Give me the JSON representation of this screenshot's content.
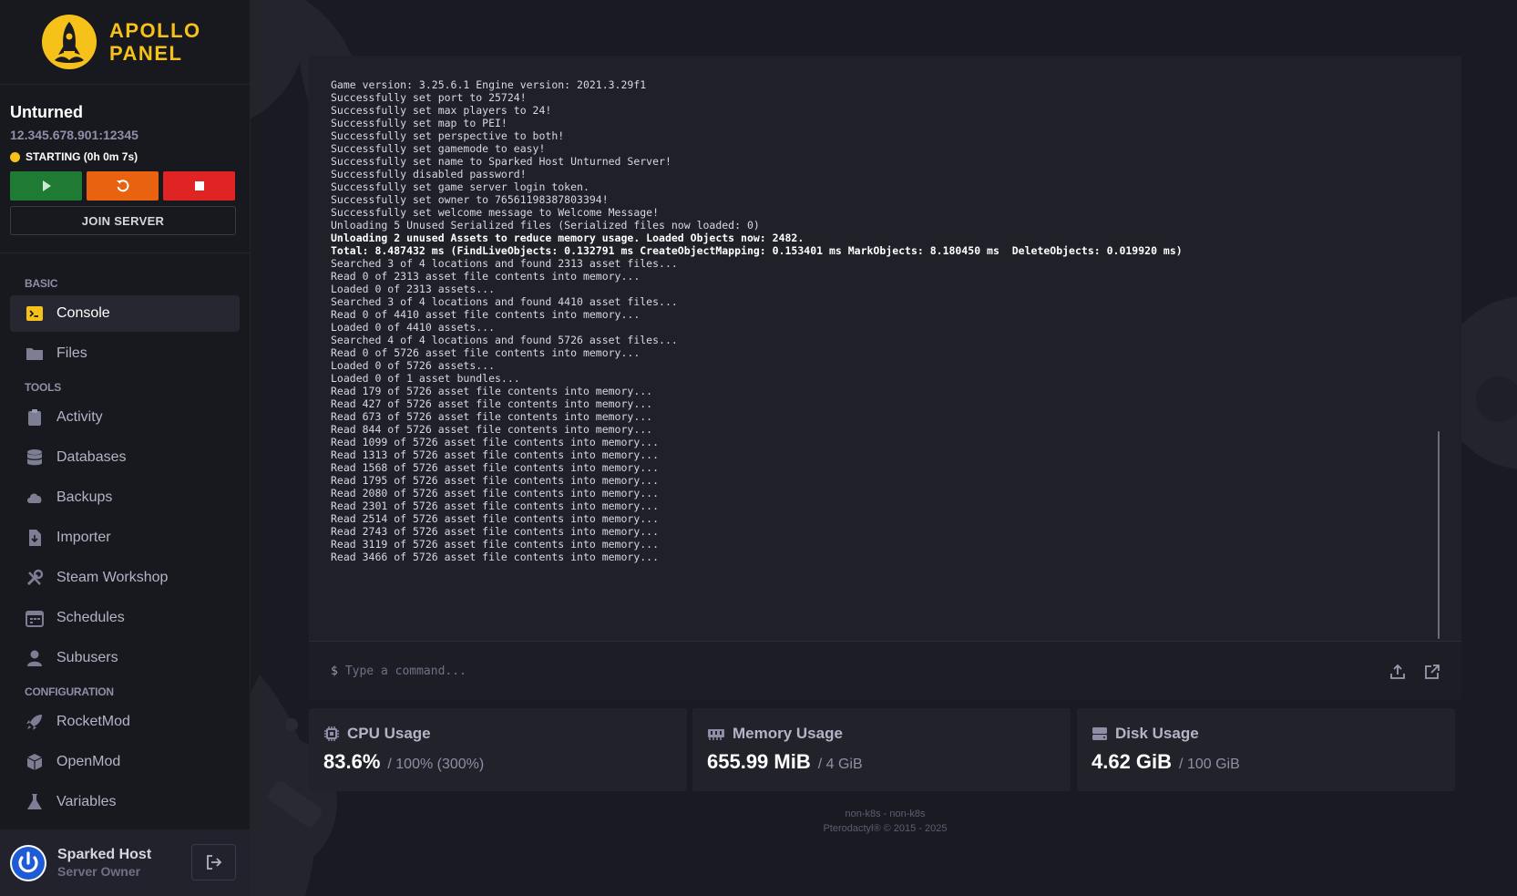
{
  "brand": {
    "line1": "APOLLO",
    "line2": "PANEL"
  },
  "server": {
    "name": "Unturned",
    "address": "12.345.678.901:12345",
    "status": "STARTING (0h 0m 7s)",
    "join_label": "JOIN SERVER"
  },
  "nav": {
    "basic_title": "BASIC",
    "tools_title": "TOOLS",
    "config_title": "CONFIGURATION",
    "console": "Console",
    "files": "Files",
    "activity": "Activity",
    "databases": "Databases",
    "backups": "Backups",
    "importer": "Importer",
    "steam_workshop": "Steam Workshop",
    "schedules": "Schedules",
    "subusers": "Subusers",
    "rocketmod": "RocketMod",
    "openmod": "OpenMod",
    "variables": "Variables"
  },
  "user": {
    "name": "Sparked Host",
    "role": "Server Owner"
  },
  "console": {
    "lines": [
      "Game version: 3.25.6.1 Engine version: 2021.3.29f1",
      "Successfully set port to 25724!",
      "Successfully set max players to 24!",
      "Successfully set map to PEI!",
      "Successfully set perspective to both!",
      "Successfully set gamemode to easy!",
      "Successfully set name to Sparked Host Unturned Server!",
      "Successfully disabled password!",
      "Successfully set game server login token.",
      "Successfully set owner to 76561198387803394!",
      "Successfully set welcome message to Welcome Message!",
      "Unloading 5 Unused Serialized files (Serialized files now loaded: 0)",
      "Unloading 2 unused Assets to reduce memory usage. Loaded Objects now: 2482.",
      "Total: 8.487432 ms (FindLiveObjects: 0.132791 ms CreateObjectMapping: 0.153401 ms MarkObjects: 8.180450 ms  DeleteObjects: 0.019920 ms)",
      "Searched 3 of 4 locations and found 2313 asset files...",
      "Read 0 of 2313 asset file contents into memory...",
      "Loaded 0 of 2313 assets...",
      "Searched 3 of 4 locations and found 4410 asset files...",
      "Read 0 of 4410 asset file contents into memory...",
      "Loaded 0 of 4410 assets...",
      "Searched 4 of 4 locations and found 5726 asset files...",
      "Read 0 of 5726 asset file contents into memory...",
      "Loaded 0 of 5726 assets...",
      "Loaded 0 of 1 asset bundles...",
      "Read 179 of 5726 asset file contents into memory...",
      "Read 427 of 5726 asset file contents into memory...",
      "Read 673 of 5726 asset file contents into memory...",
      "Read 844 of 5726 asset file contents into memory...",
      "Read 1099 of 5726 asset file contents into memory...",
      "Read 1313 of 5726 asset file contents into memory...",
      "Read 1568 of 5726 asset file contents into memory...",
      "Read 1795 of 5726 asset file contents into memory...",
      "Read 2080 of 5726 asset file contents into memory...",
      "Read 2301 of 5726 asset file contents into memory...",
      "Read 2514 of 5726 asset file contents into memory...",
      "Read 2743 of 5726 asset file contents into memory...",
      "Read 3119 of 5726 asset file contents into memory...",
      "Read 3466 of 5726 asset file contents into memory..."
    ],
    "strong_lines": [
      12,
      13
    ],
    "prompt": "$",
    "placeholder": "Type a command..."
  },
  "stats": {
    "cpu": {
      "title": "CPU Usage",
      "value": "83.6%",
      "limit": "/ 100% (300%)"
    },
    "memory": {
      "title": "Memory Usage",
      "value": "655.99 MiB",
      "limit": "/ 4 GiB"
    },
    "disk": {
      "title": "Disk Usage",
      "value": "4.62 GiB",
      "limit": "/ 100 GiB"
    }
  },
  "footer": {
    "line1": "non-k8s - non-k8s",
    "line2": "Pterodactyl® © 2015 - 2025"
  },
  "colors": {
    "accent": "#f6c21a",
    "start": "#1f7a34",
    "restart": "#e8620f",
    "stop": "#e02424"
  }
}
